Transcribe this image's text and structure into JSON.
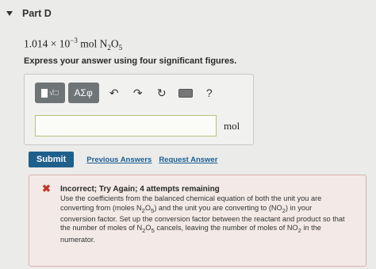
{
  "part": {
    "title": "Part D"
  },
  "question": {
    "value": "1.014 × 10",
    "exponent": "−3",
    "unit_prefix": " mol N",
    "sub1": "2",
    "unit_mid": "O",
    "sub2": "5"
  },
  "instruction": "Express your answer using four significant figures.",
  "toolbar": {
    "template_icon_label": "√□",
    "greek_label": "ΑΣφ",
    "undo_icon": "↶",
    "redo_icon": "↷",
    "reset_icon": "↻",
    "help_label": "?"
  },
  "answer": {
    "value": "",
    "units": "mol"
  },
  "actions": {
    "submit_label": "Submit",
    "previous_answers_label": "Previous Answers",
    "request_answer_label": "Request Answer"
  },
  "feedback": {
    "icon": "✖",
    "title": "Incorrect; Try Again; 4 attempts remaining",
    "line1": "Use the coefficients from the balanced chemical equation of both the unit you are",
    "line2a": "converting from (moles N",
    "line2b": "2",
    "line2c": "O",
    "line2d": "5",
    "line2e": ") and the unit you are converting to (NO",
    "line2f": "2",
    "line2g": ") in your",
    "line3": "conversion factor. Set up the conversion factor between the reactant and product so that",
    "line4a": "the number of moles of N",
    "line4b": "2",
    "line4c": "O",
    "line4d": "5",
    "line4e": " cancels, leaving the number of moles of NO",
    "line4f": "2",
    "line4g": " in the",
    "line5": "numerator."
  },
  "colors": {
    "submit": "#1f5f8b",
    "link": "#1b5f94",
    "error": "#c0392b",
    "input_border": "#b6c27a"
  }
}
